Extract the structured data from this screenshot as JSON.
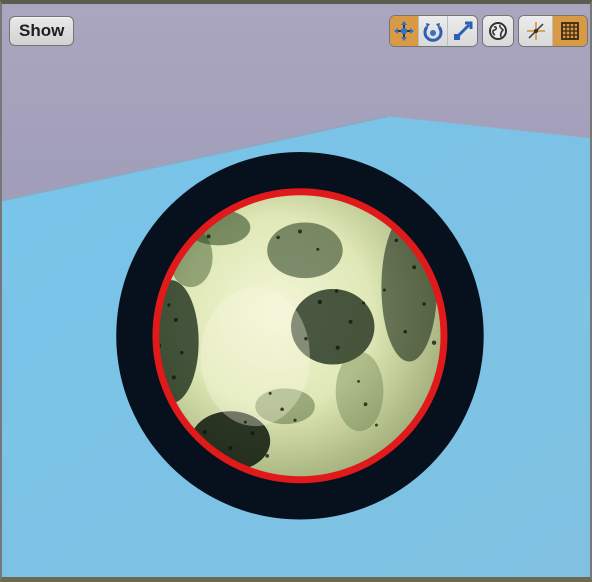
{
  "viewport": {
    "show_label": "Show",
    "toolbar_icons": {
      "translate": "translate-icon",
      "rotate": "rotate-icon",
      "scale": "scale-icon",
      "world": "world-space-icon",
      "surface_snapping": "surface-snapping-icon",
      "grid_snapping": "grid-snapping-icon"
    },
    "colors": {
      "sky": "#9b97b8",
      "plane": "#78c2e7",
      "accent": "#d99a45",
      "selection_outline": "#e0191b"
    }
  }
}
